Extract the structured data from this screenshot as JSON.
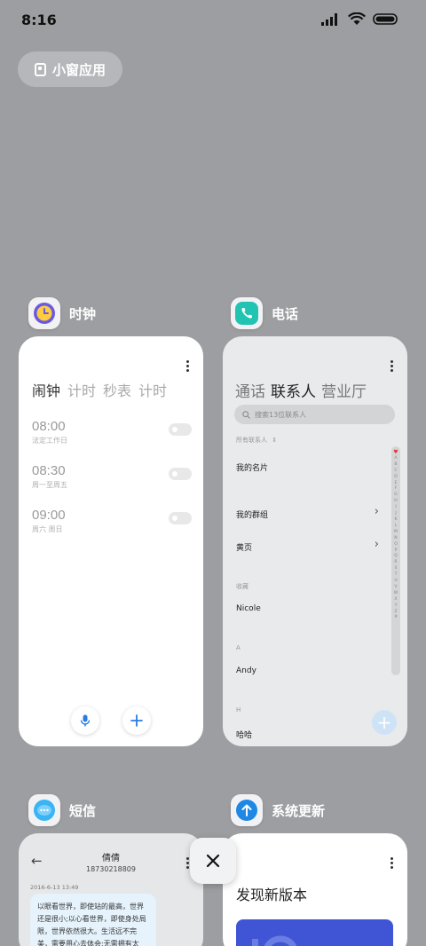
{
  "status_bar": {
    "time": "8:16"
  },
  "small_window": {
    "label": "小窗应用"
  },
  "apps": {
    "clock": {
      "title": "时钟",
      "tabs": [
        "闹钟",
        "计时",
        "秒表",
        "计时"
      ],
      "alarms": [
        {
          "time": "08:00",
          "repeat": "法定工作日"
        },
        {
          "time": "08:30",
          "repeat": "周一至周五"
        },
        {
          "time": "09:00",
          "repeat": "周六 周日"
        }
      ]
    },
    "phone": {
      "title": "电话",
      "tabs": [
        "通话",
        "联系人",
        "营业厅"
      ],
      "search_placeholder": "搜索13位联系人",
      "all_contacts_label": "所有联系人",
      "my_card": "我的名片",
      "my_groups": "我的群组",
      "yellow_pages": "黄页",
      "favorites_label": "收藏",
      "contacts": [
        {
          "section": "",
          "name": "Nicole"
        },
        {
          "section": "A",
          "name": "Andy"
        },
        {
          "section": "H",
          "name": "哈哈"
        }
      ],
      "alphabet": [
        "A",
        "B",
        "C",
        "D",
        "E",
        "F",
        "G",
        "H",
        "I",
        "J",
        "K",
        "L",
        "M",
        "N",
        "O",
        "P",
        "Q",
        "R",
        "S",
        "T",
        "U",
        "V",
        "W",
        "X",
        "Y",
        "Z",
        "#"
      ]
    },
    "sms": {
      "title": "短信",
      "contact_name": "倩倩",
      "contact_number": "18730218809",
      "date": "2016-6-13 13:49",
      "message": "以眼看世界，即使站的最高，世界还是很小;以心看世界，即使身处局限，世界依然很大。生活远不完美，需要用心去体会;无需拥有太"
    },
    "update": {
      "title": "系统更新",
      "headline": "发现新版本"
    }
  },
  "colors": {
    "background": "#9d9ea1",
    "clock_accent": "#6a5ae0",
    "phone_accent": "#21c4b2",
    "sms_accent": "#39b4f4",
    "update_accent": "#1e88e5"
  }
}
